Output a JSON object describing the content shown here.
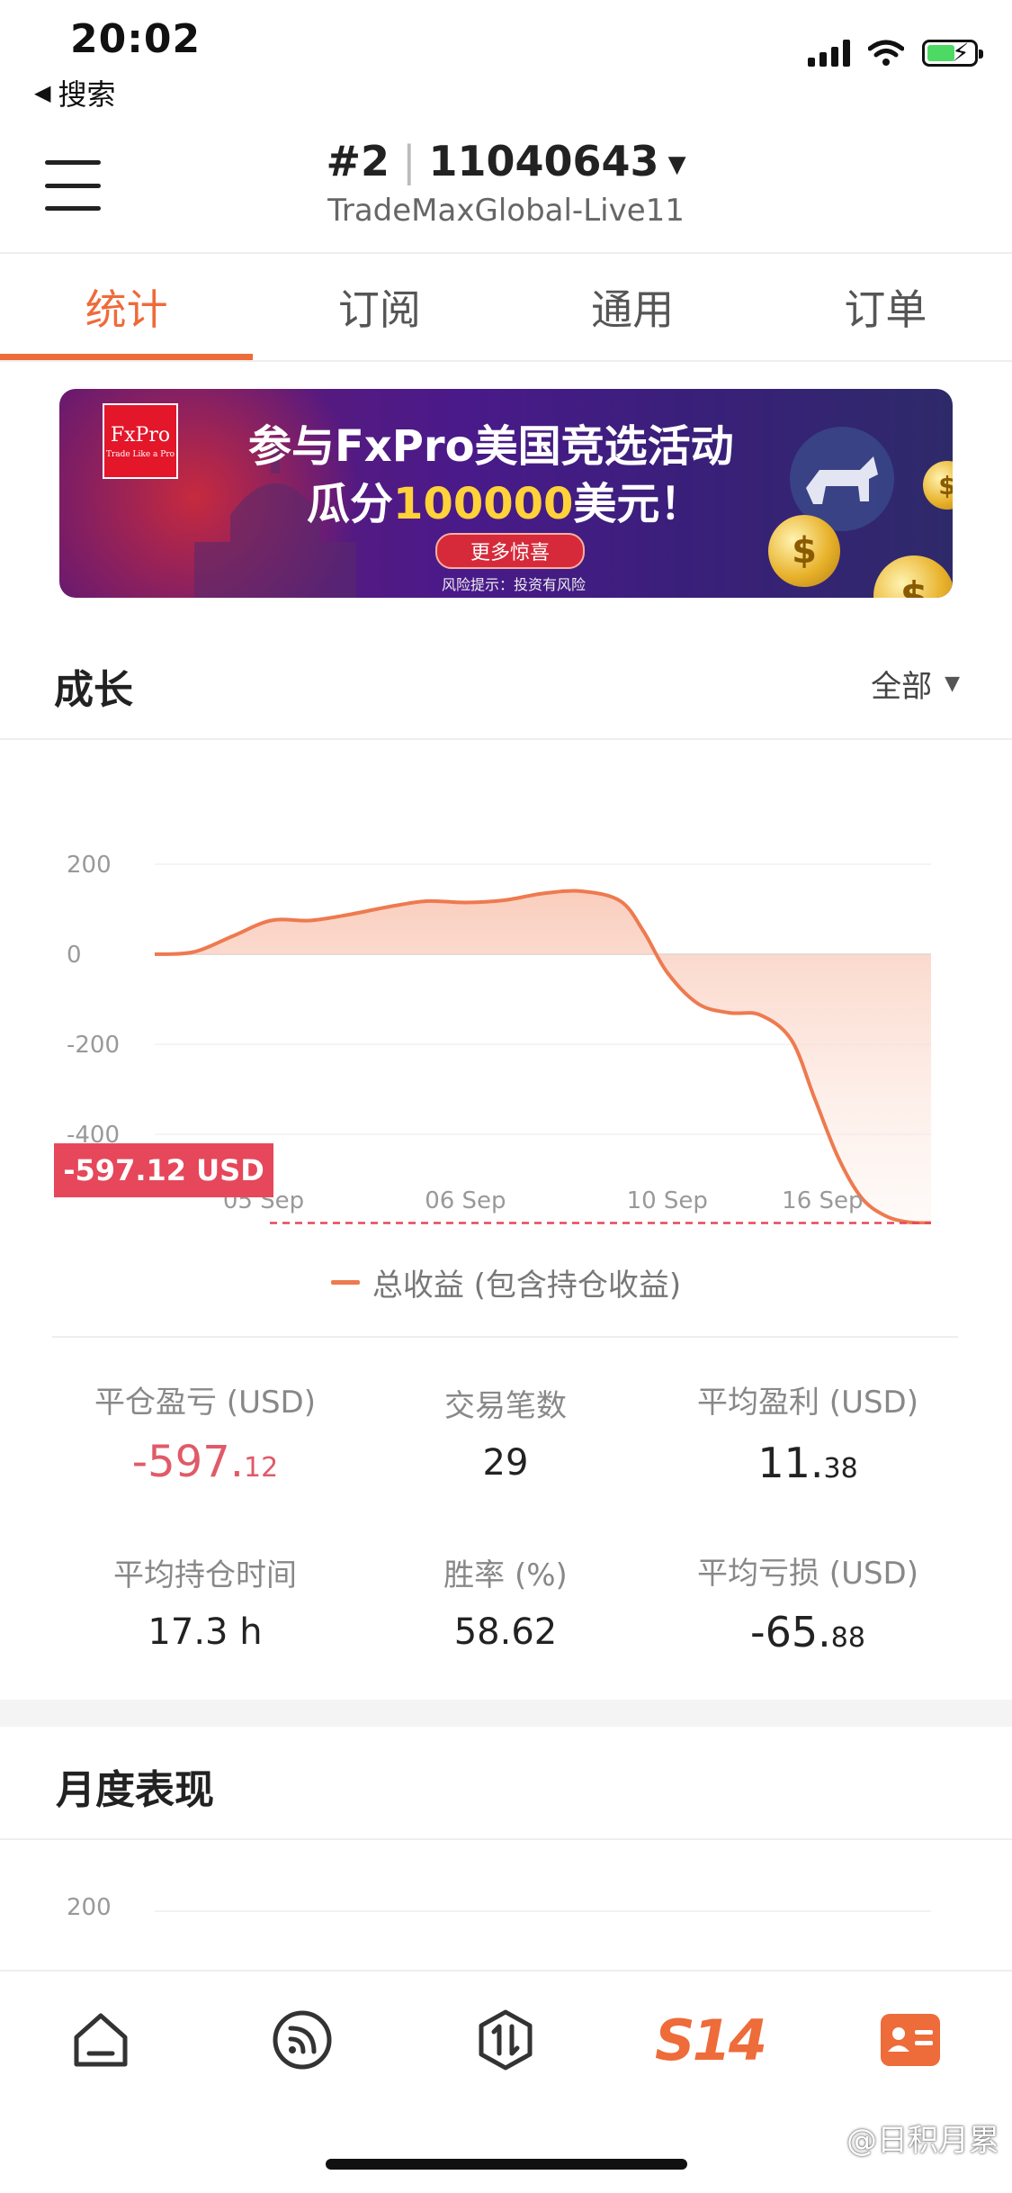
{
  "status_bar": {
    "time": "20:02",
    "back_label": "搜索"
  },
  "header": {
    "account_prefix": "#2",
    "account_id": "11040643",
    "server": "TradeMaxGlobal-Live11"
  },
  "tabs": [
    {
      "label": "统计",
      "active": true
    },
    {
      "label": "订阅",
      "active": false
    },
    {
      "label": "通用",
      "active": false
    },
    {
      "label": "订单",
      "active": false
    }
  ],
  "banner": {
    "logo_text": "FxPro",
    "logo_sub": "Trade Like a Pro",
    "line1": "参与FxPro美国竞选活动",
    "line2_prefix": "瓜分",
    "line2_amount": "100000",
    "line2_suffix": "美元！",
    "button": "更多惊喜",
    "risk": "风险提示：投资有风险"
  },
  "growth": {
    "title": "成长",
    "range": "全部",
    "final_value_label": "-597.12 USD",
    "legend": "总收益 (包含持仓收益)"
  },
  "chart_data": {
    "type": "area",
    "title": "",
    "xlabel": "",
    "ylabel": "",
    "ylim": [
      -597.12,
      200
    ],
    "yticks": [
      200,
      0,
      -200,
      -400
    ],
    "x_tick_labels": [
      "05 Sep",
      "06 Sep",
      "10 Sep",
      "16 Sep"
    ],
    "series": [
      {
        "name": "总收益 (包含持仓收益)",
        "color": "#ee7a4f",
        "x": [
          0,
          0.05,
          0.1,
          0.15,
          0.2,
          0.25,
          0.3,
          0.35,
          0.4,
          0.45,
          0.5,
          0.55,
          0.6,
          0.63,
          0.66,
          0.7,
          0.74,
          0.78,
          0.82,
          0.85,
          0.88,
          0.91,
          0.94,
          0.97,
          1.0
        ],
        "values": [
          0,
          5,
          40,
          75,
          75,
          88,
          105,
          118,
          115,
          120,
          135,
          140,
          118,
          50,
          -40,
          -110,
          -130,
          -135,
          -190,
          -320,
          -450,
          -540,
          -580,
          -595,
          -597.12
        ]
      }
    ],
    "final_value": -597.12,
    "grid": true
  },
  "stats": [
    {
      "label": "平仓盈亏 (USD)",
      "int": "-597.",
      "dec": "12",
      "negative": true
    },
    {
      "label": "交易笔数",
      "int": "29",
      "dec": "",
      "negative": false
    },
    {
      "label": "平均盈利 (USD)",
      "int": "11.",
      "dec": "38",
      "negative": false
    },
    {
      "label": "平均持仓时间",
      "int": "17.3 h",
      "dec": "",
      "negative": false
    },
    {
      "label": "胜率 (%)",
      "int": "58.62",
      "dec": "",
      "negative": false
    },
    {
      "label": "平均亏损 (USD)",
      "int": "-65.",
      "dec": "88",
      "negative": false
    }
  ],
  "monthly": {
    "title": "月度表现",
    "first_tick": "200"
  },
  "bottom_nav": [
    {
      "icon": "home-icon"
    },
    {
      "icon": "signal-feed-icon"
    },
    {
      "icon": "trade-icon"
    },
    {
      "icon": "s14-logo-icon",
      "text": "S14"
    },
    {
      "icon": "profile-card-icon"
    }
  ],
  "watermark": "@日积月累",
  "colors": {
    "accent": "#ee6b3a",
    "line": "#ee7a4f",
    "negative": "#e05a68",
    "tag": "#e6475a"
  }
}
